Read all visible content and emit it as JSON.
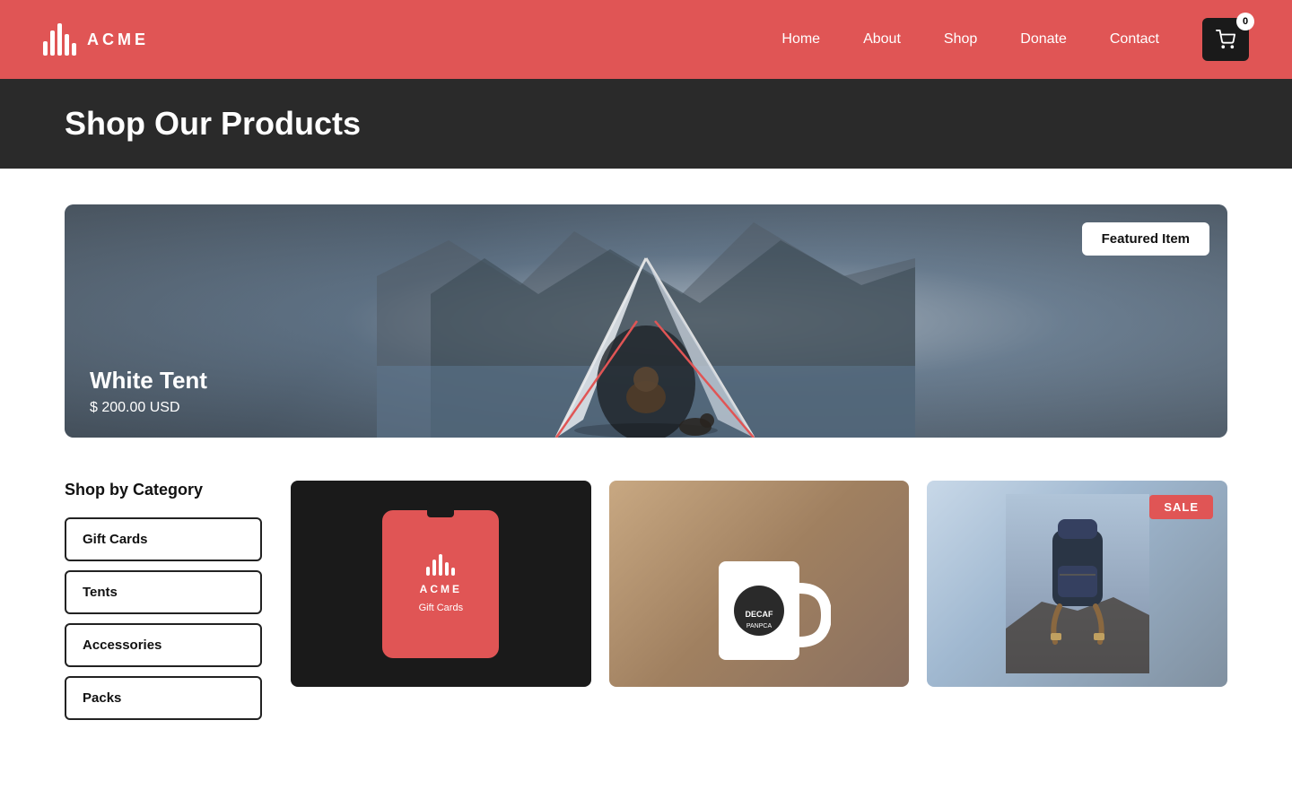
{
  "header": {
    "logo_text": "ACME",
    "nav_items": [
      {
        "label": "Home",
        "href": "#"
      },
      {
        "label": "About",
        "href": "#"
      },
      {
        "label": "Shop",
        "href": "#"
      },
      {
        "label": "Donate",
        "href": "#"
      },
      {
        "label": "Contact",
        "href": "#"
      }
    ],
    "cart_count": "0"
  },
  "page_banner": {
    "title": "Shop Our Products"
  },
  "featured": {
    "badge": "Featured Item",
    "product_name": "White Tent",
    "price": "$ 200.00 USD"
  },
  "sidebar": {
    "title": "Shop by Category",
    "categories": [
      {
        "label": "Gift Cards"
      },
      {
        "label": "Tents"
      },
      {
        "label": "Accessories"
      },
      {
        "label": "Packs"
      }
    ]
  },
  "products": [
    {
      "id": "gift-cards",
      "type": "gift-card",
      "badge": null
    },
    {
      "id": "mug",
      "type": "mug",
      "badge": null
    },
    {
      "id": "pack",
      "type": "pack",
      "badge": "SALE"
    }
  ],
  "gift_card": {
    "brand": "ACME",
    "label": "Gift Cards"
  }
}
